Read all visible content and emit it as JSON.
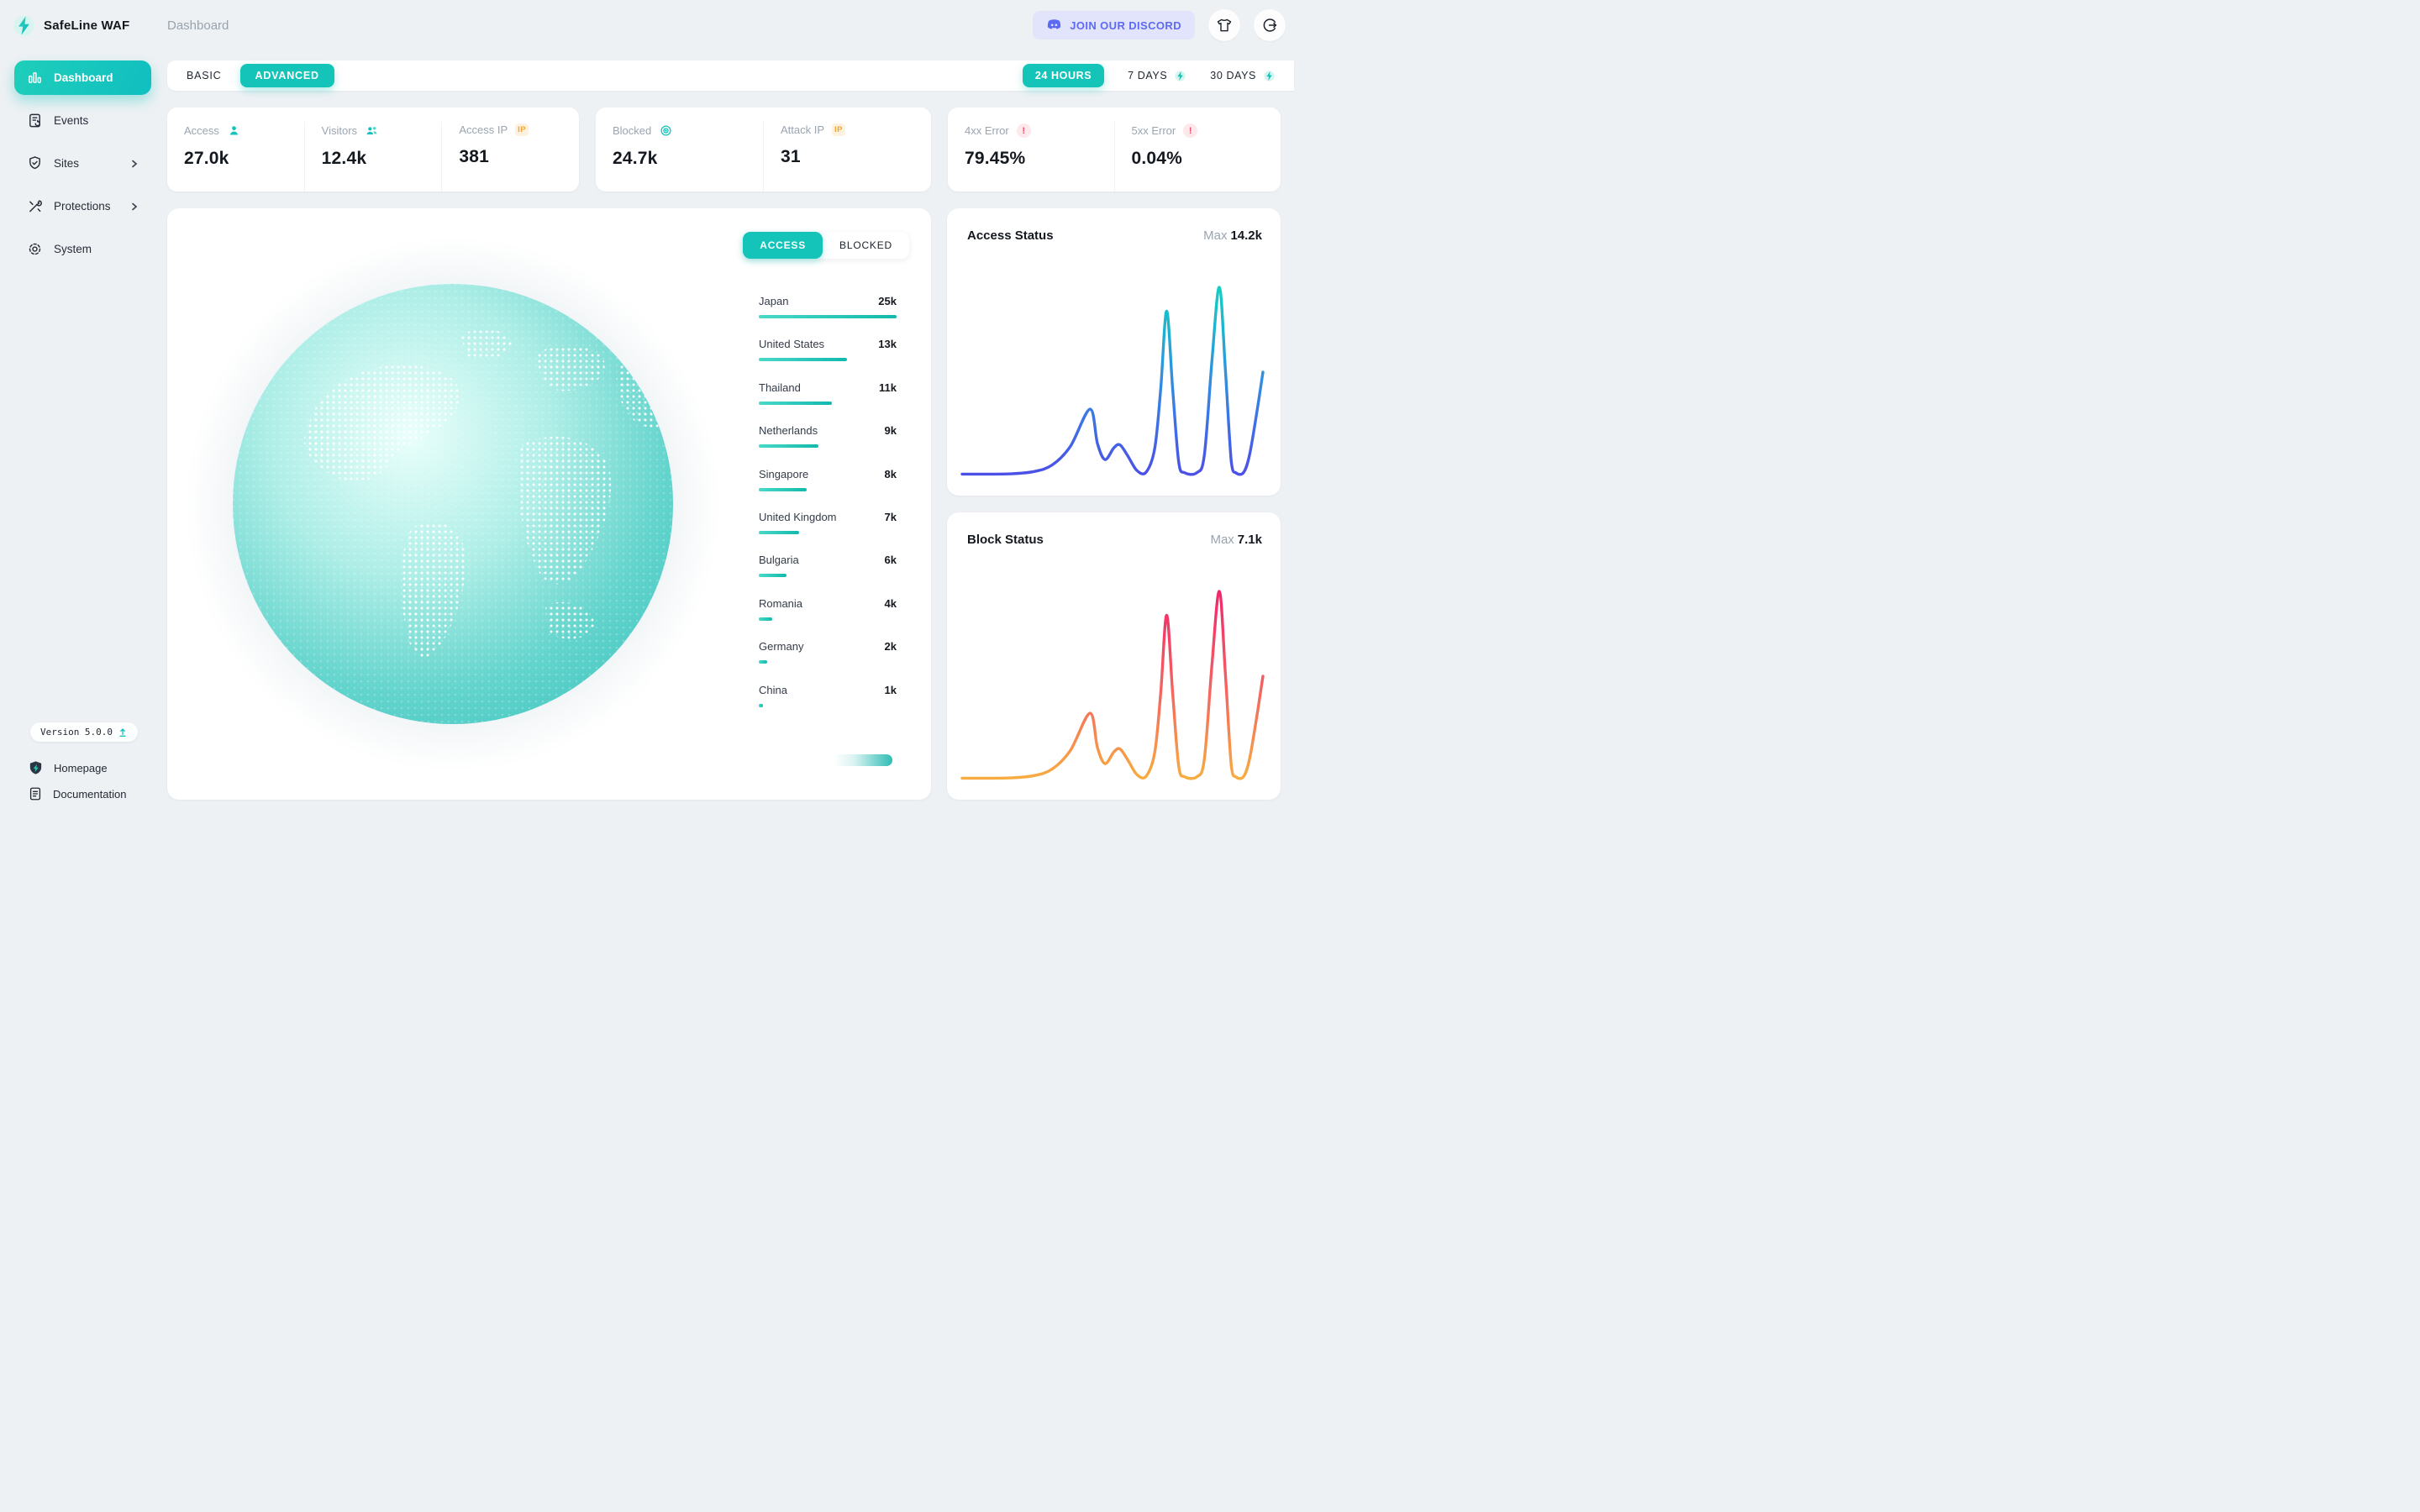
{
  "header": {
    "app_name": "SafeLine WAF",
    "breadcrumb": "Dashboard",
    "discord_label": "JOIN OUR DISCORD"
  },
  "sidebar": {
    "items": [
      {
        "label": "Dashboard",
        "active": true
      },
      {
        "label": "Events"
      },
      {
        "label": "Sites",
        "chevron": true
      },
      {
        "label": "Protections",
        "chevron": true
      },
      {
        "label": "System"
      }
    ],
    "version": "Version 5.0.0",
    "links": [
      {
        "label": "Homepage"
      },
      {
        "label": "Documentation"
      }
    ]
  },
  "toolbar": {
    "modes": [
      {
        "label": "BASIC"
      },
      {
        "label": "ADVANCED",
        "active": true
      }
    ],
    "ranges": [
      {
        "label": "24 HOURS",
        "active": true
      },
      {
        "label": "7 DAYS",
        "pro": true
      },
      {
        "label": "30 DAYS",
        "pro": true
      }
    ]
  },
  "stats": {
    "groups": [
      {
        "items": [
          {
            "label": "Access",
            "icon": "user",
            "value": "27.0k"
          },
          {
            "label": "Visitors",
            "icon": "users",
            "value": "12.4k"
          },
          {
            "label": "Access IP",
            "icon": "ip",
            "value": "381"
          }
        ]
      },
      {
        "items": [
          {
            "label": "Blocked",
            "icon": "target",
            "value": "24.7k"
          },
          {
            "label": "Attack IP",
            "icon": "ip",
            "value": "31"
          }
        ]
      },
      {
        "items": [
          {
            "label": "4xx Error",
            "icon": "alert",
            "value": "79.45%"
          },
          {
            "label": "5xx Error",
            "icon": "alert",
            "value": "0.04%"
          }
        ]
      }
    ]
  },
  "map": {
    "toggle": [
      {
        "label": "ACCESS",
        "active": true
      },
      {
        "label": "BLOCKED"
      }
    ],
    "countries": [
      {
        "name": "Japan",
        "value": "25k",
        "bar_pct": 100
      },
      {
        "name": "United States",
        "value": "13k",
        "bar_pct": 64
      },
      {
        "name": "Thailand",
        "value": "11k",
        "bar_pct": 53
      },
      {
        "name": "Netherlands",
        "value": "9k",
        "bar_pct": 43
      },
      {
        "name": "Singapore",
        "value": "8k",
        "bar_pct": 35
      },
      {
        "name": "United Kingdom",
        "value": "7k",
        "bar_pct": 29
      },
      {
        "name": "Bulgaria",
        "value": "6k",
        "bar_pct": 20
      },
      {
        "name": "Romania",
        "value": "4k",
        "bar_pct": 10
      },
      {
        "name": "Germany",
        "value": "2k",
        "bar_pct": 6
      },
      {
        "name": "China",
        "value": "1k",
        "bar_pct": 3
      }
    ]
  },
  "chart_data": [
    {
      "id": "access",
      "type": "line",
      "title": "Access Status",
      "max_label": "Max",
      "max_value_label": "14.2k",
      "ymax": 14.2,
      "x": [
        0,
        8,
        16,
        24,
        30,
        36,
        42.5,
        45,
        47.5,
        50.5,
        52.5,
        55,
        58,
        61,
        64,
        66,
        68,
        70,
        72,
        74,
        78,
        80.5,
        83,
        85.5,
        87.5,
        89.5,
        91,
        93.5,
        95.5,
        98,
        100
      ],
      "y": [
        0.1,
        0.1,
        0.12,
        0.3,
        0.8,
        2.2,
        5.0,
        2.4,
        1.2,
        2.1,
        2.3,
        1.5,
        0.4,
        0.2,
        2.0,
        6.5,
        12.4,
        6.5,
        1.0,
        0.2,
        0.2,
        1.5,
        8.5,
        14.2,
        8.0,
        1.0,
        0.2,
        0.2,
        1.5,
        4.8,
        7.8
      ],
      "gradient": [
        "#0fd0c4",
        "#3686e2",
        "#4b50e6"
      ]
    },
    {
      "id": "block",
      "type": "line",
      "title": "Block Status",
      "max_label": "Max",
      "max_value_label": "7.1k",
      "ymax": 7.1,
      "x": [
        0,
        8,
        16,
        24,
        30,
        36,
        42.5,
        45,
        47.5,
        50.5,
        52.5,
        55,
        58,
        61,
        64,
        66,
        68,
        70,
        72,
        74,
        78,
        80.5,
        83,
        85.5,
        87.5,
        89.5,
        91,
        93.5,
        95.5,
        98,
        100
      ],
      "y": [
        0.05,
        0.05,
        0.06,
        0.15,
        0.4,
        1.1,
        2.5,
        1.2,
        0.6,
        1.05,
        1.15,
        0.75,
        0.2,
        0.1,
        1.0,
        3.25,
        6.2,
        3.25,
        0.5,
        0.1,
        0.1,
        0.75,
        4.25,
        7.1,
        4.0,
        0.5,
        0.1,
        0.1,
        0.75,
        2.4,
        3.9
      ],
      "gradient": [
        "#f2266d",
        "#f3685f",
        "#f7ac40"
      ]
    }
  ],
  "colors": {
    "accent_teal": "#15c4b9",
    "discord_purple": "#5d6af2",
    "ip_badge_orange": "#f0a32f",
    "alert_red": "#f4516c"
  }
}
